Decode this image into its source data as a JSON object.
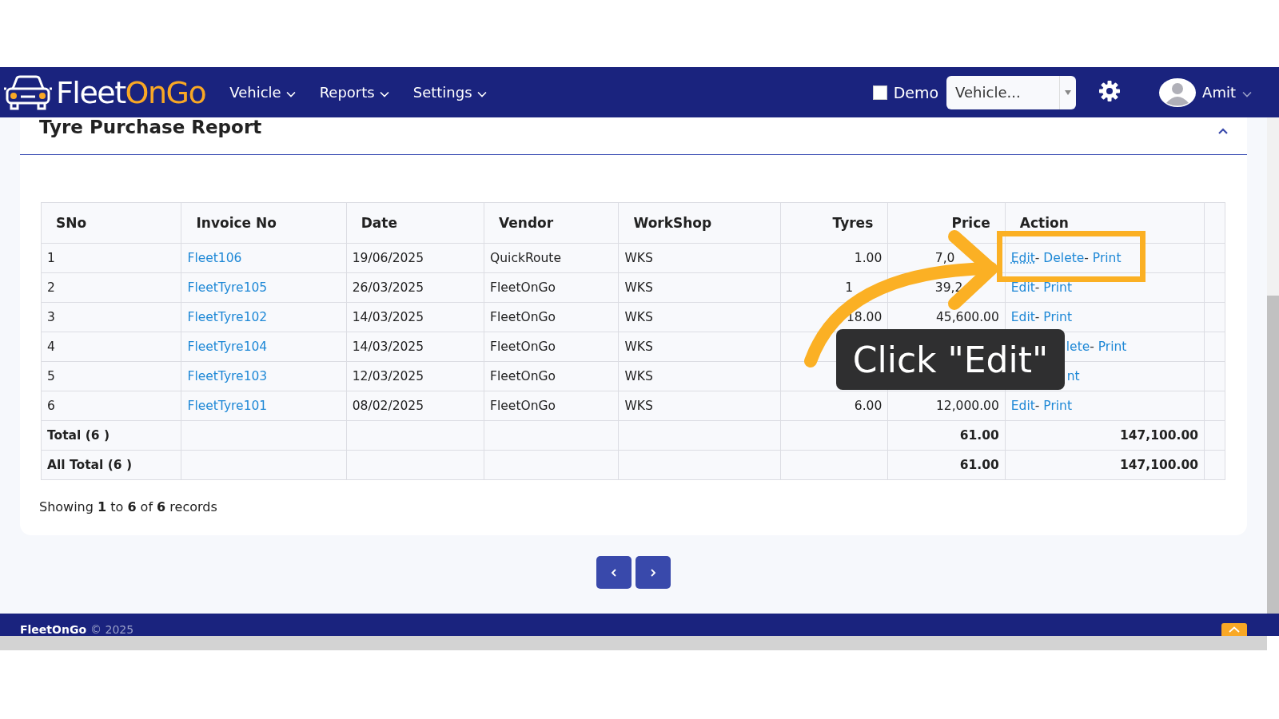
{
  "header": {
    "logo": {
      "part_1": "Fleet",
      "part_2": "OnGo"
    },
    "menu": [
      {
        "label": "Vehicle"
      },
      {
        "label": "Reports"
      },
      {
        "label": "Settings"
      }
    ],
    "demo": {
      "label": "Demo",
      "checked": false
    },
    "vehicle_select": {
      "placeholder": "Vehicle..."
    },
    "user": {
      "name": "Amit"
    }
  },
  "report": {
    "title": "Tyre Purchase Report",
    "table": {
      "columns": [
        {
          "label": "SNo",
          "kind": "text"
        },
        {
          "label": "Invoice No",
          "kind": "link"
        },
        {
          "label": "Date",
          "kind": "text"
        },
        {
          "label": "Vendor",
          "kind": "text"
        },
        {
          "label": "WorkShop",
          "kind": "text"
        },
        {
          "label": "Tyres",
          "kind": "number"
        },
        {
          "label": "Price",
          "kind": "number"
        },
        {
          "label": "Action",
          "kind": "actions"
        },
        {
          "kind": "blank"
        }
      ],
      "rows": [
        {
          "cells": [
            "1",
            "Fleet106",
            "19/06/2025",
            "QuickRoute",
            "WKS",
            "1.00",
            {
              "text": "7,0",
              "kind": "cut"
            }
          ],
          "actions": [
            {
              "label": "Edit",
              "hovered": true
            },
            {
              "separator": "- ",
              "label": "Delete",
              "hovered": false
            },
            {
              "separator": "- ",
              "label": "Print",
              "hovered": false
            }
          ]
        },
        {
          "cells": [
            "2",
            "FleetTyre105",
            "26/03/2025",
            "FleetOnGo",
            "WKS",
            {
              "text": "1",
              "kind": "cut"
            },
            {
              "text": "39,2",
              "kind": "cut"
            }
          ],
          "actions": [
            {
              "label": "Edit",
              "hovered": false
            },
            {
              "separator": "- ",
              "label": "Print",
              "hovered": false
            }
          ]
        },
        {
          "cells": [
            "3",
            "FleetTyre102",
            "14/03/2025",
            "FleetOnGo",
            "WKS",
            "18.00",
            "45,600.00"
          ],
          "actions": [
            {
              "label": "Edit",
              "hovered": false
            },
            {
              "separator": "- ",
              "label": "Print",
              "hovered": false
            }
          ]
        },
        {
          "cells": [
            "4",
            "FleetTyre104",
            "14/03/2025",
            "FleetOnGo",
            "WKS"
          ],
          "actions": [
            {
              "kind": "delete",
              "label": "lete",
              "hovered": false
            },
            {
              "separator": "- ",
              "label": "Print",
              "hovered": false
            }
          ]
        },
        {
          "cells": [
            "5",
            "FleetTyre103",
            "12/03/2025",
            "FleetOnGo",
            "WKS"
          ],
          "actions": [
            {
              "kind": "print",
              "label": "nt",
              "hovered": false
            }
          ]
        },
        {
          "cells": [
            "6",
            "FleetTyre101",
            "08/02/2025",
            "FleetOnGo",
            "WKS",
            "6.00",
            "12,000.00"
          ],
          "actions": [
            {
              "label": "Edit",
              "hovered": false
            },
            {
              "separator": "- ",
              "label": "Print",
              "hovered": false
            }
          ]
        }
      ],
      "totals": [
        {
          "label": "Total (6 )",
          "tyres": "61.00",
          "price": "147,100.00"
        },
        {
          "label": "All Total (6 )",
          "tyres": "61.00",
          "price": "147,100.00"
        }
      ]
    },
    "summary": "Showing **1** to **6** of **6** records"
  },
  "footer": {
    "brand": "FleetOnGo",
    "copyright": "© 2025"
  },
  "callout": {
    "text": "Click \"Edit\""
  }
}
